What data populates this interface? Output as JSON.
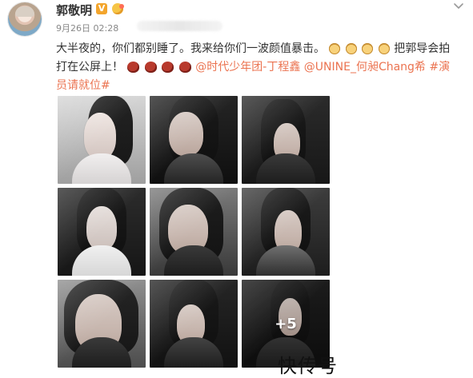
{
  "profile": {
    "username": "郭敬明",
    "vip_badge": "V",
    "timestamp": "9月26日 02:28"
  },
  "post": {
    "text_1": "大半夜的，你们都别睡了。我来给你们一波颜值暴击。",
    "text_2": "把郭导会拍打在公屏上！",
    "mention_1": "@时代少年团-丁程鑫",
    "mention_2": "@UNINE_何昶Chang希",
    "hashtag_1": "#演员请就位#"
  },
  "gallery": {
    "more_count": "+5"
  },
  "watermark": "快传号",
  "icons": {
    "more": "chevron-down-icon",
    "vip": "vip-badge-icon",
    "fan": "fan-icon",
    "emoji_dog": "dog-emoji-icon",
    "emoji_duck": "duck-emoji-icon"
  },
  "colors": {
    "accent": "#eb7350",
    "text": "#333333",
    "muted": "#888888"
  }
}
